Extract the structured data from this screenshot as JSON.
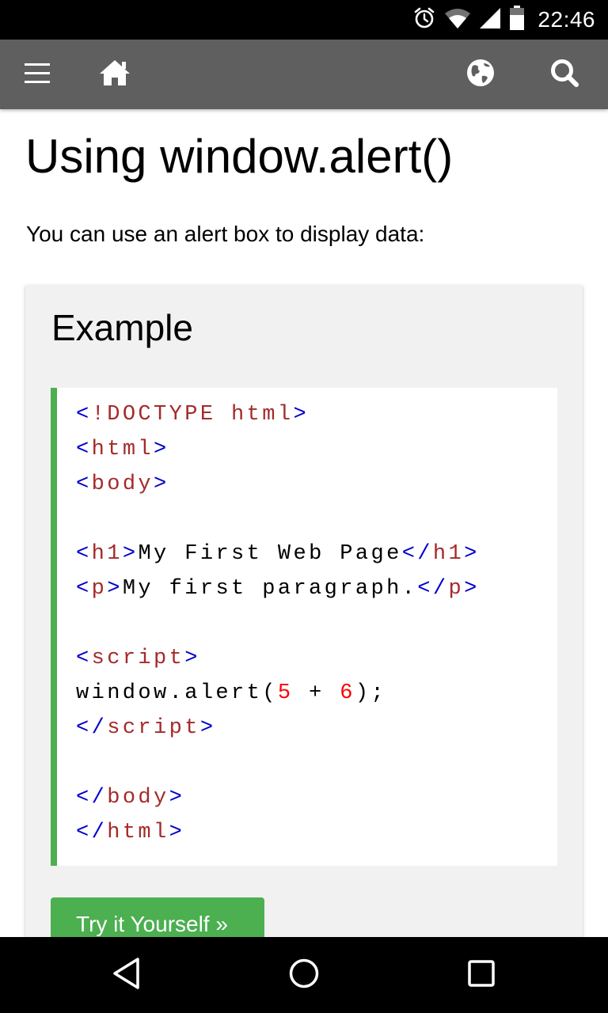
{
  "status_bar": {
    "time": "22:46",
    "icons": [
      "alarm-icon",
      "wifi-icon",
      "cell-signal-icon",
      "battery-icon"
    ]
  },
  "nav": {
    "icons": [
      "menu-icon",
      "home-icon",
      "globe-icon",
      "search-icon"
    ],
    "background": "#5f5f5f"
  },
  "page": {
    "title": "Using window.alert()",
    "intro": "You can use an alert box to display data:"
  },
  "example": {
    "heading": "Example",
    "code_lines": [
      [
        {
          "t": "br",
          "v": "<"
        },
        {
          "t": "tg",
          "v": "!DOCTYPE html"
        },
        {
          "t": "br",
          "v": ">"
        }
      ],
      [
        {
          "t": "br",
          "v": "<"
        },
        {
          "t": "tg",
          "v": "html"
        },
        {
          "t": "br",
          "v": ">"
        }
      ],
      [
        {
          "t": "br",
          "v": "<"
        },
        {
          "t": "tg",
          "v": "body"
        },
        {
          "t": "br",
          "v": ">"
        }
      ],
      [],
      [
        {
          "t": "br",
          "v": "<"
        },
        {
          "t": "tg",
          "v": "h1"
        },
        {
          "t": "br",
          "v": ">"
        },
        {
          "t": "plain",
          "v": "My First Web Page"
        },
        {
          "t": "br",
          "v": "</"
        },
        {
          "t": "tg",
          "v": "h1"
        },
        {
          "t": "br",
          "v": ">"
        }
      ],
      [
        {
          "t": "br",
          "v": "<"
        },
        {
          "t": "tg",
          "v": "p"
        },
        {
          "t": "br",
          "v": ">"
        },
        {
          "t": "plain",
          "v": "My first paragraph."
        },
        {
          "t": "br",
          "v": "</"
        },
        {
          "t": "tg",
          "v": "p"
        },
        {
          "t": "br",
          "v": ">"
        }
      ],
      [],
      [
        {
          "t": "br",
          "v": "<"
        },
        {
          "t": "tg",
          "v": "script"
        },
        {
          "t": "br",
          "v": ">"
        }
      ],
      [
        {
          "t": "plain",
          "v": "window.alert("
        },
        {
          "t": "num",
          "v": "5"
        },
        {
          "t": "plain",
          "v": " + "
        },
        {
          "t": "num",
          "v": "6"
        },
        {
          "t": "plain",
          "v": ");"
        }
      ],
      [
        {
          "t": "br",
          "v": "</"
        },
        {
          "t": "tg",
          "v": "script"
        },
        {
          "t": "br",
          "v": ">"
        }
      ],
      [],
      [
        {
          "t": "br",
          "v": "</"
        },
        {
          "t": "tg",
          "v": "body"
        },
        {
          "t": "br",
          "v": ">"
        }
      ],
      [
        {
          "t": "br",
          "v": "</"
        },
        {
          "t": "tg",
          "v": "html"
        },
        {
          "t": "br",
          "v": ">"
        }
      ]
    ],
    "try_button": "Try it Yourself »",
    "accent": "#4caf50"
  },
  "android_nav": {
    "icons": [
      "back-icon",
      "home-circle-icon",
      "recent-apps-icon"
    ]
  }
}
